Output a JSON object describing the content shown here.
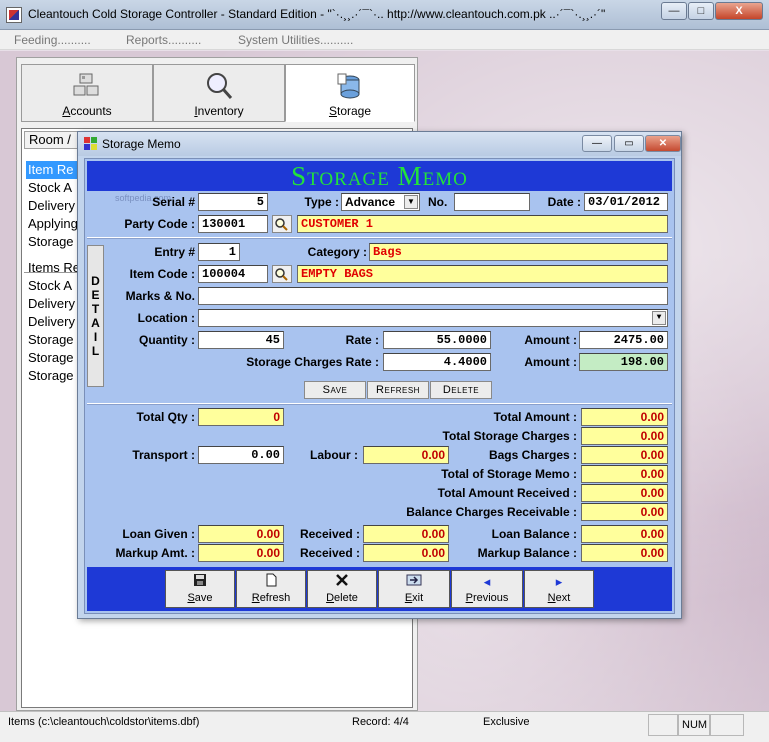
{
  "window": {
    "title": "Cleantouch Cold Storage Controller - Standard Edition  -  \"`·.¸¸.·´¯`·.. http://www.cleantouch.com.pk ..·´¯`·.¸¸.·´\"",
    "min_label": "—",
    "max_label": "□",
    "close_label": "X"
  },
  "menu": {
    "items": [
      "Feeding..........",
      "Reports..........",
      "System Utilities.........."
    ]
  },
  "tabs": [
    {
      "label": "Accounts",
      "icon": "accounts-icon"
    },
    {
      "label": "Inventory",
      "icon": "magnifier-icon"
    },
    {
      "label": "Storage",
      "icon": "storage-icon"
    }
  ],
  "listbox": {
    "header": "Room /",
    "rows_top": [
      "Item Re",
      "Stock A",
      "Delivery",
      "Applying",
      "Storage"
    ],
    "rows_bottom": [
      "Items Re",
      "Stock A",
      "Delivery",
      "Delivery",
      "Storage",
      "Storage",
      "Storage"
    ]
  },
  "dialog": {
    "title": "Storage Memo",
    "heading": "Storage Memo",
    "watermark": "softpedia.com",
    "labels": {
      "serial": "Serial #",
      "type": "Type :",
      "no": "No.",
      "date": "Date :",
      "party_code": "Party Code :",
      "entry": "Entry #",
      "category": "Category :",
      "item_code": "Item Code :",
      "marks": "Marks & No.",
      "location": "Location :",
      "quantity": "Quantity :",
      "rate": "Rate :",
      "amount": "Amount :",
      "storage_rate": "Storage Charges Rate :",
      "amount2": "Amount :",
      "total_qty": "Total Qty :",
      "total_amount": "Total Amount :",
      "total_storage": "Total Storage Charges :",
      "transport": "Transport :",
      "labour": "Labour :",
      "bags_charges": "Bags Charges :",
      "total_memo": "Total of Storage Memo :",
      "total_received": "Total Amount Received :",
      "balance_receivable": "Balance Charges Receivable :",
      "loan_given": "Loan Given :",
      "received1": "Received :",
      "loan_balance": "Loan Balance :",
      "markup_amt": "Markup Amt. :",
      "received2": "Received :",
      "markup_balance": "Markup Balance :"
    },
    "values": {
      "serial": "5",
      "type": "Advance",
      "no": "",
      "date": "03/01/2012",
      "party_code": "130001",
      "party_name": "CUSTOMER 1",
      "entry": "1",
      "category": "Bags",
      "item_code": "100004",
      "item_name": "EMPTY BAGS",
      "marks": "",
      "location": "",
      "quantity": "45",
      "rate": "55.0000",
      "amount": "2475.00",
      "storage_rate": "4.4000",
      "storage_amount": "198.00",
      "total_qty": "0",
      "total_amount": "0.00",
      "total_storage": "0.00",
      "transport": "0.00",
      "labour": "0.00",
      "bags_charges": "0.00",
      "total_memo": "0.00",
      "total_received": "0.00",
      "balance_receivable": "0.00",
      "loan_given": "0.00",
      "received1": "0.00",
      "loan_balance": "0.00",
      "markup_amt": "0.00",
      "received2": "0.00",
      "markup_balance": "0.00"
    },
    "detail_tab": "DETAIL",
    "detail_buttons": [
      "Save",
      "Refresh",
      "Delete"
    ],
    "bottom_buttons": [
      {
        "label": "Save",
        "icon": "floppy-icon"
      },
      {
        "label": "Refresh",
        "icon": "document-icon"
      },
      {
        "label": "Delete",
        "icon": "x-icon"
      },
      {
        "label": "Exit",
        "icon": "exit-icon"
      },
      {
        "label": "Previous",
        "icon": "left-arrow-icon"
      },
      {
        "label": "Next",
        "icon": "right-arrow-icon"
      }
    ]
  },
  "status": {
    "file": "Items (c:\\cleantouch\\coldstor\\items.dbf)",
    "record": "Record: 4/4",
    "mode": "Exclusive",
    "num": "NUM"
  },
  "colors": {
    "form_bg": "#a9c3ef",
    "header_bar": "#1e39d6",
    "heading_text": "#22e23b",
    "highlight_field": "#ffff9c",
    "red_text": "#e00000"
  }
}
